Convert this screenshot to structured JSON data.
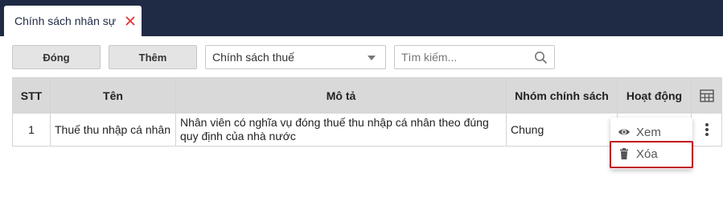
{
  "app": {
    "tab": {
      "label": "Chính sách nhân sự",
      "close_icon": "close-icon",
      "close_color": "#e03232"
    }
  },
  "toolbar": {
    "close_label": "Đóng",
    "add_label": "Thêm",
    "filter_select": {
      "selected": "Chính sách thuế"
    },
    "search": {
      "placeholder": "Tìm kiếm...",
      "value": ""
    }
  },
  "table": {
    "columns": [
      "STT",
      "Tên",
      "Mô tả",
      "Nhóm chính sách",
      "Hoạt động"
    ],
    "column_config_icon": "table-settings-icon",
    "rows": [
      {
        "stt": "1",
        "name": "Thuế thu nhập cá nhân",
        "description": "Nhân viên có nghĩa vụ đóng thuế thu nhập cá nhân theo đúng quy định của nhà nước",
        "group": "Chung",
        "actions_icon": "more-vertical-icon"
      }
    ]
  },
  "context_menu": {
    "items": [
      {
        "label": "Xem",
        "icon": "eye-icon"
      },
      {
        "label": "Xóa",
        "icon": "trash-icon"
      }
    ],
    "highlighted_item": "Xóa",
    "highlight_color": "#c0121c"
  },
  "colors": {
    "topbar": "#1f2a44",
    "header_bg": "#d9d9d9",
    "button_bg": "#e4e4e4"
  }
}
